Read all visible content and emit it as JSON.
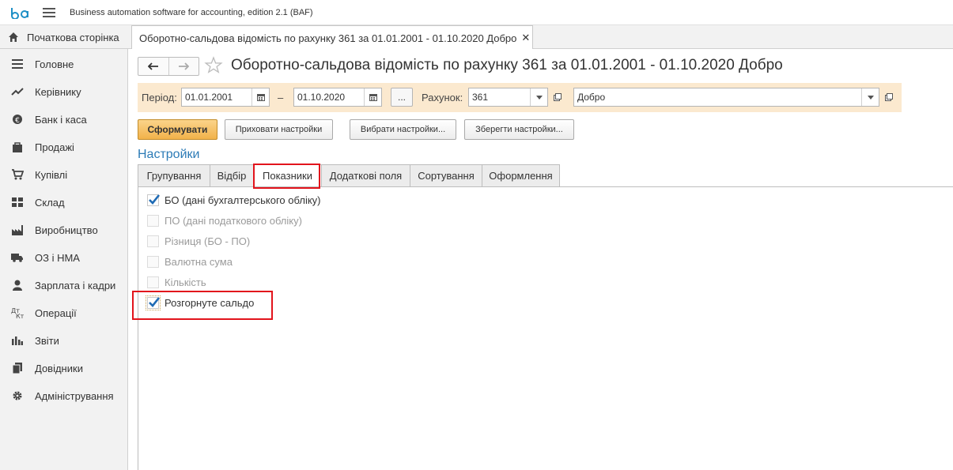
{
  "app": {
    "title": "Business automation software for accounting, edition 2.1  (BAF)"
  },
  "tabs_bar": {
    "home_label": "Початкова сторінка",
    "doc_tab_label": "Оборотно-сальдова відомість по рахунку 361 за 01.01.2001 - 01.10.2020 Добро",
    "close_glyph": "✕"
  },
  "sidebar": {
    "items": [
      {
        "label": "Головне",
        "icon": "menu-lines-icon"
      },
      {
        "label": "Керівнику",
        "icon": "trend-icon"
      },
      {
        "label": "Банк і каса",
        "icon": "coin-icon"
      },
      {
        "label": "Продажі",
        "icon": "bag-icon"
      },
      {
        "label": "Купівлі",
        "icon": "cart-icon"
      },
      {
        "label": "Склад",
        "icon": "grid-icon"
      },
      {
        "label": "Виробництво",
        "icon": "factory-icon"
      },
      {
        "label": "ОЗ і НМА",
        "icon": "truck-icon"
      },
      {
        "label": "Зарплата і кадри",
        "icon": "person-icon"
      },
      {
        "label": "Операції",
        "icon": "dt-kt-icon"
      },
      {
        "label": "Звіти",
        "icon": "bar-chart-icon"
      },
      {
        "label": "Довідники",
        "icon": "books-icon"
      },
      {
        "label": "Адміністрування",
        "icon": "gear-icon"
      }
    ]
  },
  "report": {
    "title": "Оборотно-сальдова відомість по рахунку 361 за 01.01.2001 - 01.10.2020 Добро",
    "period_label": "Період:",
    "period_from": "01.01.2001",
    "period_dash": "–",
    "period_to": "01.10.2020",
    "period_more": "...",
    "account_label": "Рахунок:",
    "account_value": "361",
    "counterparty_value": "Добро"
  },
  "buttons": {
    "generate": "Сформувати",
    "hide_settings": "Приховати настройки",
    "choose_settings": "Вибрати настройки...",
    "save_settings": "Зберегти настройки..."
  },
  "settings": {
    "title": "Настройки",
    "tabs": [
      "Групування",
      "Відбір",
      "Показники",
      "Додаткові поля",
      "Сортування",
      "Оформлення"
    ],
    "active_tab": "Показники",
    "options": [
      {
        "label": "БО (дані бухгалтерського обліку)",
        "checked": true,
        "enabled": true
      },
      {
        "label": "ПО (дані податкового обліку)",
        "checked": false,
        "enabled": false
      },
      {
        "label": "Різниця (БО - ПО)",
        "checked": false,
        "enabled": false
      },
      {
        "label": "Валютна сума",
        "checked": false,
        "enabled": false
      },
      {
        "label": "Кількість",
        "checked": false,
        "enabled": false
      },
      {
        "label": "Розгорнуте сальдо",
        "checked": true,
        "enabled": true
      }
    ]
  },
  "colors": {
    "accent": "#2c7bb6",
    "filter_bg": "#fbe9cf",
    "primary_btn": "#f1b24a",
    "highlight": "#e2141c"
  }
}
